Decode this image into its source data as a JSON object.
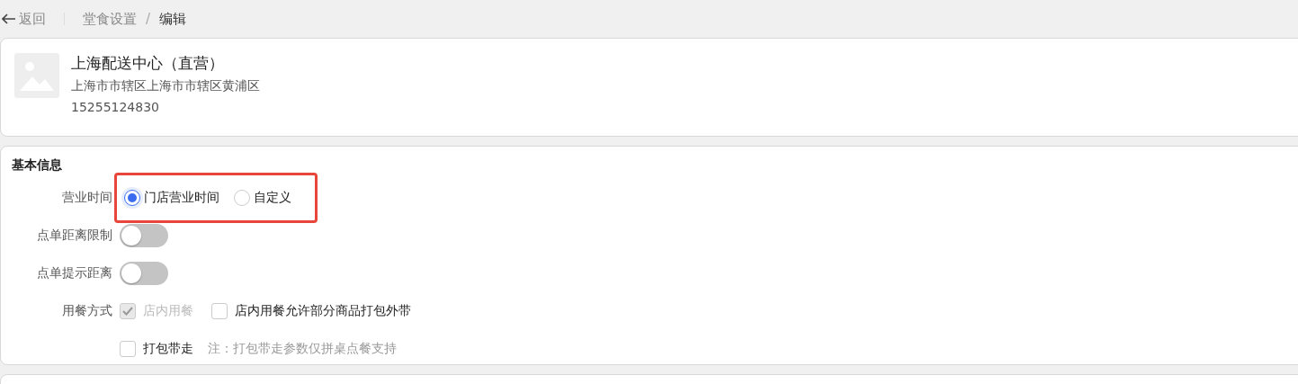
{
  "breadcrumb": {
    "back": "返回",
    "items": [
      {
        "label": "堂食设置",
        "current": false
      },
      {
        "label": "编辑",
        "current": true
      }
    ],
    "separator": "/"
  },
  "store": {
    "name": "上海配送中心（直营）",
    "address": "上海市市辖区上海市市辖区黄浦区",
    "phone": "15255124830"
  },
  "section": {
    "title": "基本信息",
    "fields": [
      {
        "kind": "radio",
        "label": "营业时间",
        "highlighted": true,
        "options": [
          {
            "label": "门店营业时间",
            "selected": true
          },
          {
            "label": "自定义",
            "selected": false
          }
        ]
      },
      {
        "kind": "switch",
        "label": "点单距离限制",
        "on": false
      },
      {
        "kind": "switch",
        "label": "点单提示距离",
        "on": false
      },
      {
        "kind": "checkbox",
        "label": "用餐方式",
        "options": [
          {
            "label": "店内用餐",
            "checked": true,
            "disabled": true
          },
          {
            "label": "店内用餐允许部分商品打包外带",
            "checked": false
          }
        ]
      },
      {
        "kind": "checkbox",
        "options": [
          {
            "label": "打包带走",
            "checked": false
          }
        ],
        "note": "注：打包带走参数仅拼桌点餐支持"
      }
    ]
  }
}
